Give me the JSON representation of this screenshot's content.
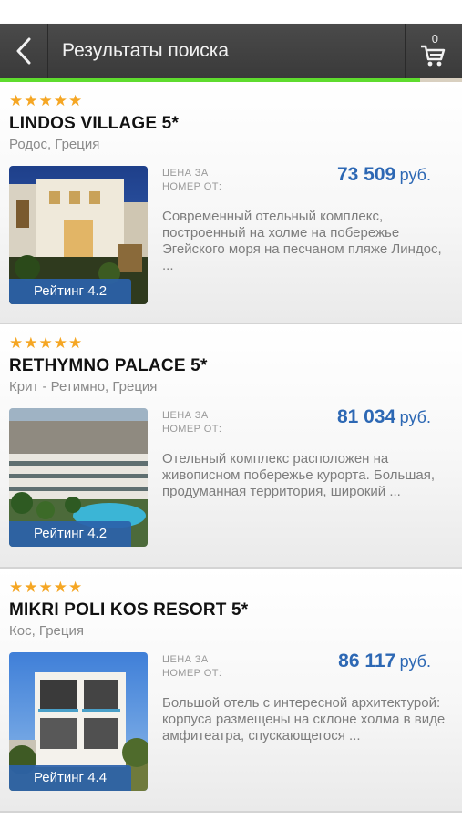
{
  "header": {
    "title": "Результаты поиска",
    "cart_count": "0",
    "progress_percent": 91
  },
  "colors": {
    "accent": "#2d68b4",
    "star": "#f5a623",
    "progress": "#5fdc2e",
    "topbar": "#3f3f3f"
  },
  "icons": [
    "chevron-left-icon",
    "cart-icon",
    "star-icon"
  ],
  "hotels": [
    {
      "name": "LINDOS VILLAGE 5*",
      "location": "Родос, Греция",
      "stars": 5,
      "price_label": "ЦЕНА ЗА НОМЕР ОТ:",
      "price": "73 509",
      "currency": "руб.",
      "rating": "Рейтинг 4.2",
      "description": "Современный отельный комплекс, построенный на холме на побережье Эгейского моря на песчаном пляже Линдос, ..."
    },
    {
      "name": "RETHYMNO PALACE 5*",
      "location": "Крит - Ретимно, Греция",
      "stars": 5,
      "price_label": "ЦЕНА ЗА НОМЕР ОТ:",
      "price": "81 034",
      "currency": "руб.",
      "rating": "Рейтинг 4.2",
      "description": "Отельный комплекс расположен на живописном побережье курорта. Большая, продуманная территория, широкий ..."
    },
    {
      "name": "MIKRI POLI KOS RESORT 5*",
      "location": "Кос, Греция",
      "stars": 5,
      "price_label": "ЦЕНА ЗА НОМЕР ОТ:",
      "price": "86 117",
      "currency": "руб.",
      "rating": "Рейтинг 4.4",
      "description": "Большой отель с интересной архитектурой: корпуса размещены на склоне холма в виде амфитеатра, спускающегося ..."
    }
  ]
}
